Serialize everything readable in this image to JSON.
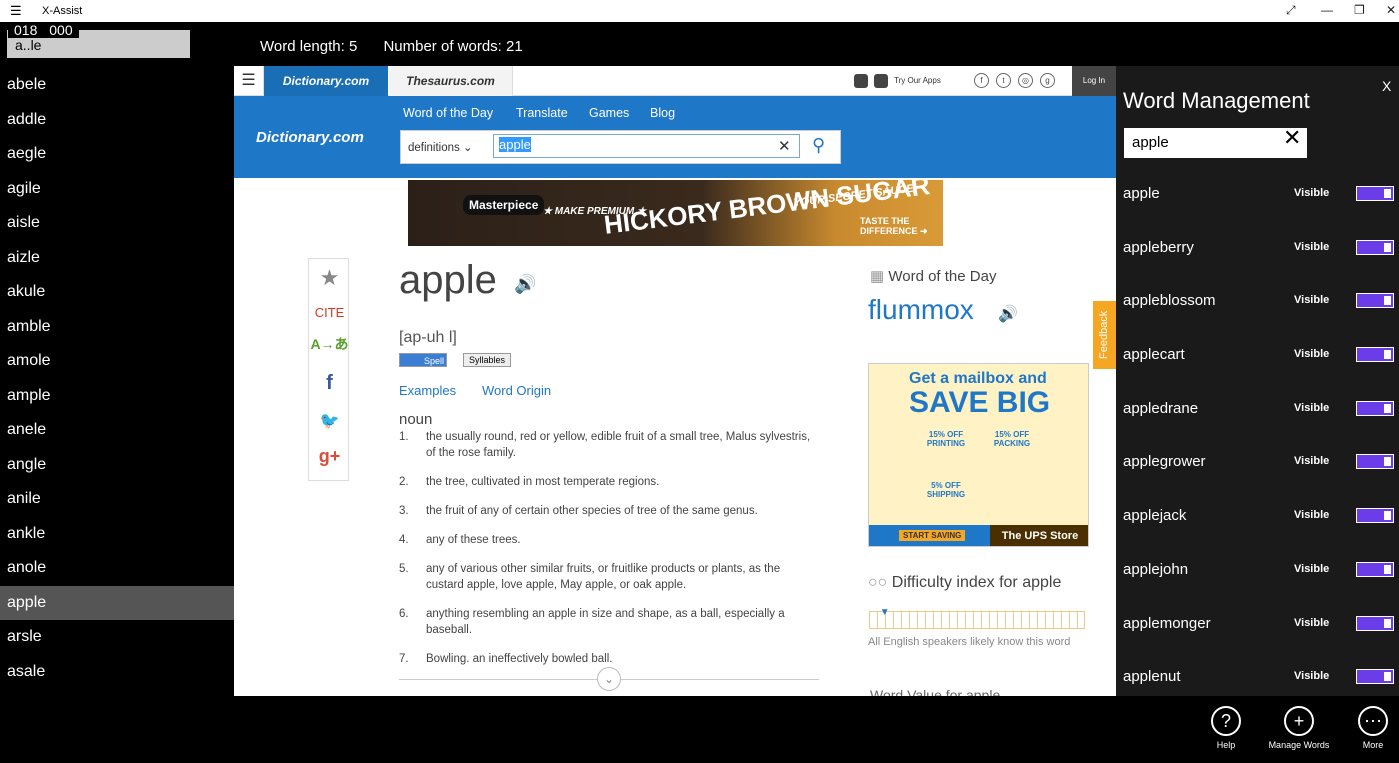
{
  "window": {
    "title": "X-Assist",
    "menu_icon": "☰",
    "fullscreen_icon": "⤢",
    "min_icon": "—",
    "max_icon": "❐",
    "close_icon": "✕"
  },
  "left": {
    "counter": "018 000",
    "pattern": "a..le",
    "words": [
      "abele",
      "addle",
      "aegle",
      "agile",
      "aisle",
      "aizle",
      "akule",
      "amble",
      "amole",
      "ample",
      "anele",
      "angle",
      "anile",
      "ankle",
      "anole",
      "apple",
      "arsle",
      "asale"
    ],
    "selected": "apple"
  },
  "stats": {
    "word_length": "Word length: 5",
    "number_of_words": "Number of words: 21"
  },
  "dict": {
    "tab_dictionary": "Dictionary.com",
    "tab_thesaurus": "Thesaurus.com",
    "try_apps": "Try Our Apps",
    "login": "Log In",
    "social": [
      "f",
      "t",
      "◎",
      "g"
    ],
    "nav": [
      "Word of the Day",
      "Translate",
      "Games",
      "Blog"
    ],
    "logo": "Dictionary.com",
    "search_mode": "definitions",
    "search_value": "apple",
    "clear": "✕",
    "search_icon": "⚲",
    "ad1": {
      "brand": "Masterpiece",
      "make": "★ MAKE PREMIUM ★",
      "big": "HICKORY BROWN SUGAR",
      "tag": "YOUR SECRET SAUCE",
      "cta": "TASTE THE DIFFERENCE ➜"
    },
    "share": [
      "★",
      "CITE",
      "A→あ",
      "f",
      "🐦",
      "g+"
    ],
    "headword": "apple",
    "audio": "🔊",
    "pronunciation": "[ap-uh l]",
    "spell": "Spell",
    "syllables": "Syllables",
    "examples": "Examples",
    "word_origin": "Word Origin",
    "pos": "noun",
    "definitions": [
      {
        "n": "1.",
        "t": "the usually round, red or yellow, edible fruit of a small tree, Malus sylvestris, of the rose family."
      },
      {
        "n": "2.",
        "t": "the tree, cultivated in most temperate regions."
      },
      {
        "n": "3.",
        "t": "the fruit of any of certain other species of tree of the same genus."
      },
      {
        "n": "4.",
        "t": "any of these trees."
      },
      {
        "n": "5.",
        "t": "any of various other similar fruits, or fruitlike products or plants, as the custard apple, love apple, May apple, or oak apple."
      },
      {
        "n": "6.",
        "t": "anything resembling an apple in size and shape, as a ball, especially a baseball."
      },
      {
        "n": "7.",
        "t": "Bowling. an ineffectively bowled ball."
      }
    ],
    "chevron": "⌄",
    "wotd_heading": "Word of the Day",
    "wotd_word": "flummox",
    "ad2": {
      "l1": "Get a mailbox and",
      "l2": "SAVE BIG",
      "o1": "15% OFF PRINTING",
      "o2": "15% OFF PACKING",
      "o3": "5% OFF SHIPPING",
      "cta": "START SAVING",
      "store": "The UPS Store"
    },
    "difficulty_heading": "Difficulty index for apple",
    "difficulty_text": "All English speakers likely know this word",
    "difficulty_level": 0.05,
    "word_value": "Word Value for apple",
    "feedback": "Feedback"
  },
  "right": {
    "title": "Word Management",
    "close": "X",
    "search": "apple",
    "clear": "✕",
    "rows": [
      {
        "word": "apple",
        "status": "Visible"
      },
      {
        "word": "appleberry",
        "status": "Visible"
      },
      {
        "word": "appleblossom",
        "status": "Visible"
      },
      {
        "word": "applecart",
        "status": "Visible"
      },
      {
        "word": "appledrane",
        "status": "Visible"
      },
      {
        "word": "applegrower",
        "status": "Visible"
      },
      {
        "word": "applejack",
        "status": "Visible"
      },
      {
        "word": "applejohn",
        "status": "Visible"
      },
      {
        "word": "applemonger",
        "status": "Visible"
      },
      {
        "word": "applenut",
        "status": "Visible"
      }
    ],
    "toggle_color": "#6a3de8"
  },
  "bottom": [
    {
      "icon": "?",
      "label": "Help",
      "name": "help"
    },
    {
      "icon": "+",
      "label": "Manage Words",
      "name": "manage-words"
    },
    {
      "icon": "⋯",
      "label": "More",
      "name": "more"
    }
  ]
}
